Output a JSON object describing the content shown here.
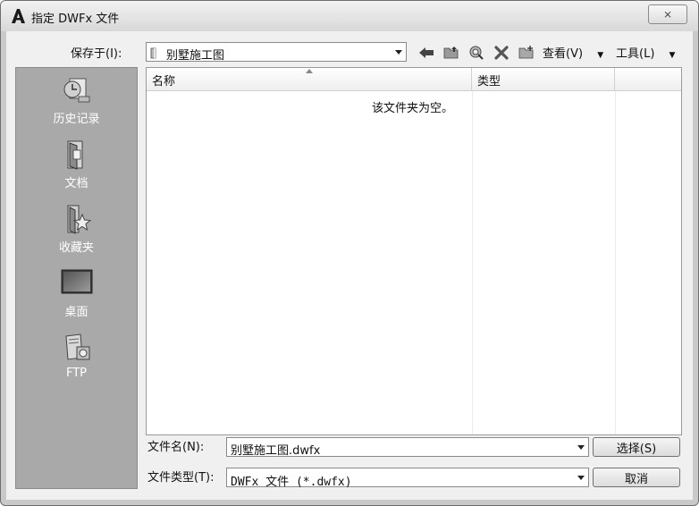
{
  "window": {
    "title": "指定 DWFx 文件",
    "close_glyph": "⨯"
  },
  "save_in": {
    "label": "保存于(I):",
    "value": "别墅施工图"
  },
  "toolbar": {
    "view_label": "查看(V)",
    "tools_label": "工具(L)",
    "icons": [
      "back-icon",
      "up-folder-icon",
      "search-web-icon",
      "delete-icon",
      "new-folder-icon",
      "views-menu-icon",
      "tools-menu-icon"
    ]
  },
  "places": [
    {
      "label": "历史记录",
      "icon": "history-icon"
    },
    {
      "label": "文档",
      "icon": "documents-icon"
    },
    {
      "label": "收藏夹",
      "icon": "favorites-icon"
    },
    {
      "label": "桌面",
      "icon": "desktop-icon"
    },
    {
      "label": "FTP",
      "icon": "ftp-icon"
    }
  ],
  "file_list": {
    "columns": [
      "名称",
      "类型"
    ],
    "empty_message": "该文件夹为空。"
  },
  "file_name": {
    "label": "文件名(N):",
    "value": "别墅施工图.dwfx"
  },
  "file_type": {
    "label": "文件类型(T):",
    "value": "DWFx 文件 (*.dwfx)"
  },
  "buttons": {
    "select": "选择(S)",
    "cancel": "取消"
  }
}
